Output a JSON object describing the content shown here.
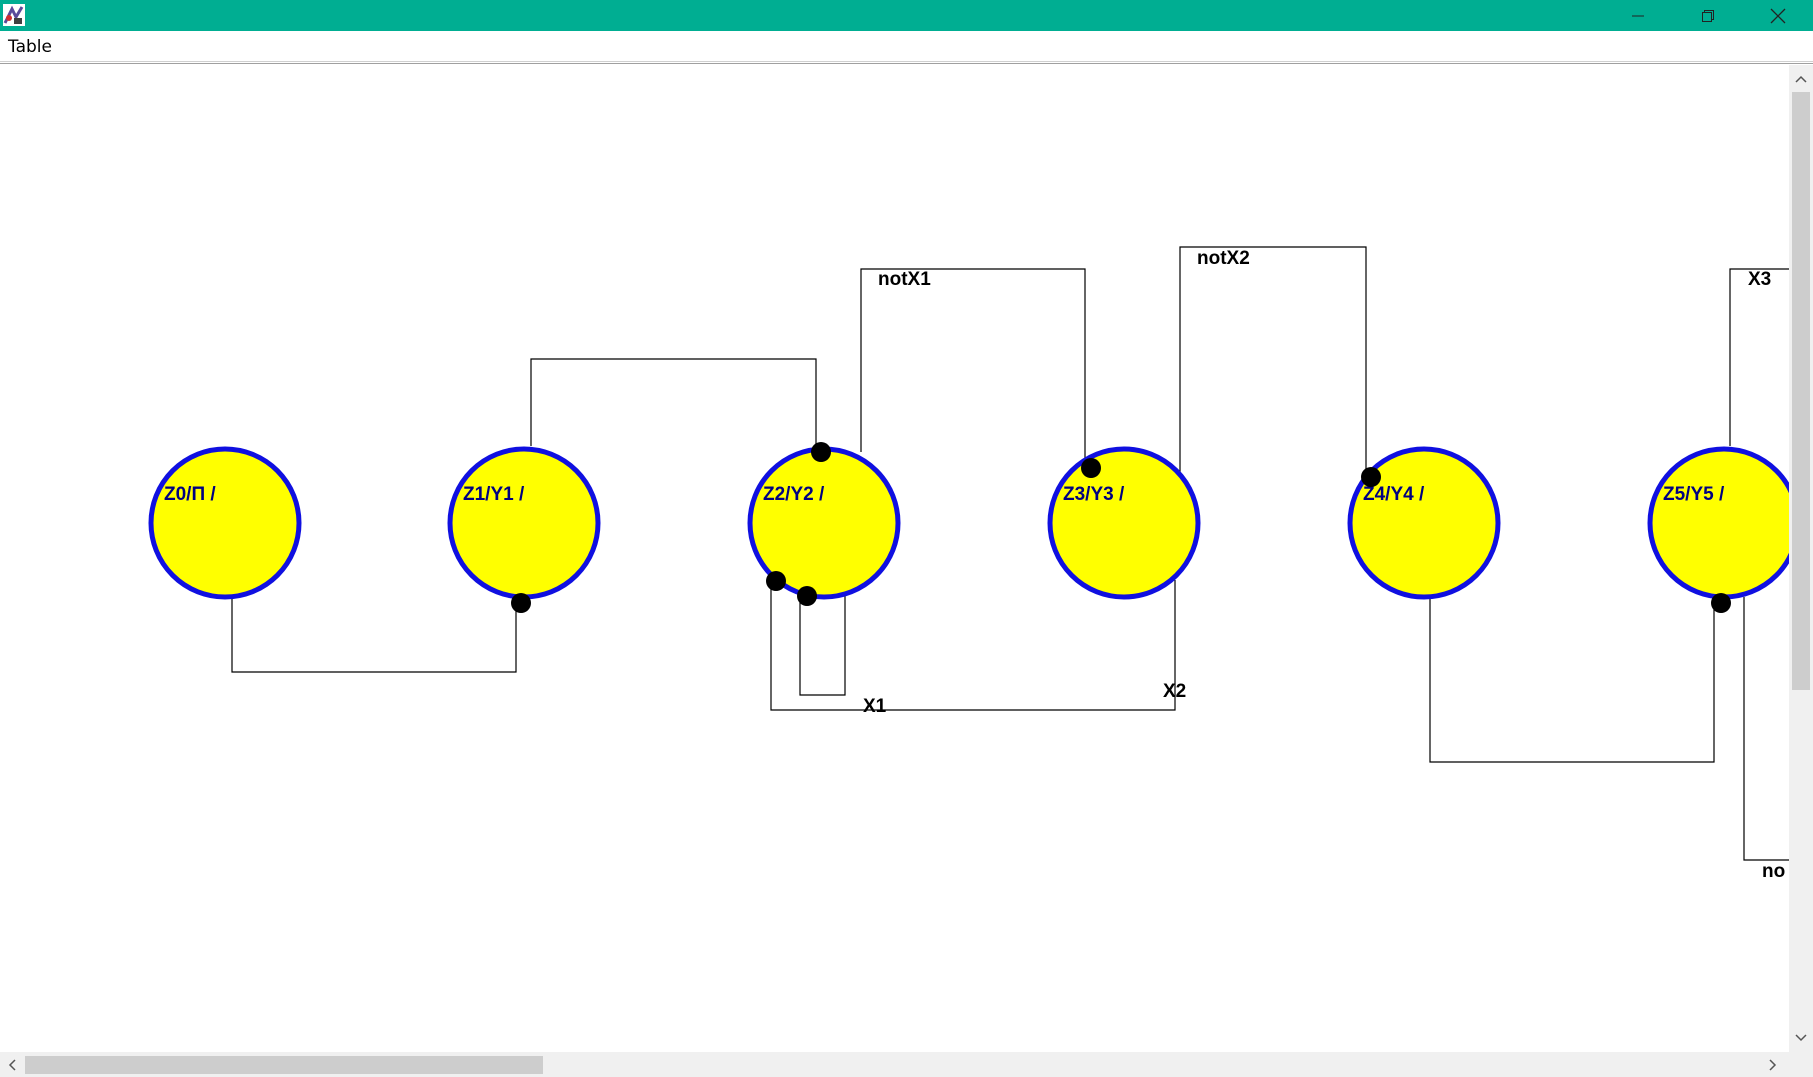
{
  "window": {
    "title": "",
    "colors": {
      "titlebar": "#00ae92",
      "state_fill": "#ffff00",
      "state_stroke": "#1010e0"
    }
  },
  "menu": {
    "items": [
      {
        "label": "Table"
      }
    ]
  },
  "diagram": {
    "states": [
      {
        "label": "Z0/П /"
      },
      {
        "label": "Z1/Y1 /"
      },
      {
        "label": "Z2/Y2 /"
      },
      {
        "label": "Z3/Y3 /"
      },
      {
        "label": "Z4/Y4 /"
      },
      {
        "label": "Z5/Y5 /"
      }
    ],
    "edge_labels": {
      "notX1": "notX1",
      "notX2": "notX2",
      "X3": "X3",
      "X1": "X1",
      "X2": "X2",
      "no": "no"
    }
  }
}
